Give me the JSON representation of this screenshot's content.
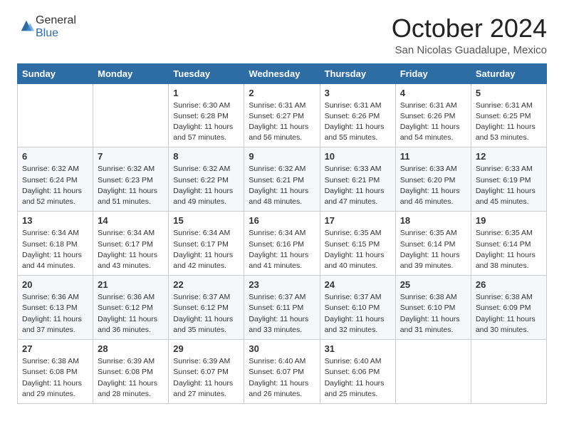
{
  "logo": {
    "general": "General",
    "blue": "Blue"
  },
  "title": "October 2024",
  "location": "San Nicolas Guadalupe, Mexico",
  "days_header": [
    "Sunday",
    "Monday",
    "Tuesday",
    "Wednesday",
    "Thursday",
    "Friday",
    "Saturday"
  ],
  "weeks": [
    [
      {
        "day": "",
        "info": ""
      },
      {
        "day": "",
        "info": ""
      },
      {
        "day": "1",
        "info": "Sunrise: 6:30 AM\nSunset: 6:28 PM\nDaylight: 11 hours and 57 minutes."
      },
      {
        "day": "2",
        "info": "Sunrise: 6:31 AM\nSunset: 6:27 PM\nDaylight: 11 hours and 56 minutes."
      },
      {
        "day": "3",
        "info": "Sunrise: 6:31 AM\nSunset: 6:26 PM\nDaylight: 11 hours and 55 minutes."
      },
      {
        "day": "4",
        "info": "Sunrise: 6:31 AM\nSunset: 6:26 PM\nDaylight: 11 hours and 54 minutes."
      },
      {
        "day": "5",
        "info": "Sunrise: 6:31 AM\nSunset: 6:25 PM\nDaylight: 11 hours and 53 minutes."
      }
    ],
    [
      {
        "day": "6",
        "info": "Sunrise: 6:32 AM\nSunset: 6:24 PM\nDaylight: 11 hours and 52 minutes."
      },
      {
        "day": "7",
        "info": "Sunrise: 6:32 AM\nSunset: 6:23 PM\nDaylight: 11 hours and 51 minutes."
      },
      {
        "day": "8",
        "info": "Sunrise: 6:32 AM\nSunset: 6:22 PM\nDaylight: 11 hours and 49 minutes."
      },
      {
        "day": "9",
        "info": "Sunrise: 6:32 AM\nSunset: 6:21 PM\nDaylight: 11 hours and 48 minutes."
      },
      {
        "day": "10",
        "info": "Sunrise: 6:33 AM\nSunset: 6:21 PM\nDaylight: 11 hours and 47 minutes."
      },
      {
        "day": "11",
        "info": "Sunrise: 6:33 AM\nSunset: 6:20 PM\nDaylight: 11 hours and 46 minutes."
      },
      {
        "day": "12",
        "info": "Sunrise: 6:33 AM\nSunset: 6:19 PM\nDaylight: 11 hours and 45 minutes."
      }
    ],
    [
      {
        "day": "13",
        "info": "Sunrise: 6:34 AM\nSunset: 6:18 PM\nDaylight: 11 hours and 44 minutes."
      },
      {
        "day": "14",
        "info": "Sunrise: 6:34 AM\nSunset: 6:17 PM\nDaylight: 11 hours and 43 minutes."
      },
      {
        "day": "15",
        "info": "Sunrise: 6:34 AM\nSunset: 6:17 PM\nDaylight: 11 hours and 42 minutes."
      },
      {
        "day": "16",
        "info": "Sunrise: 6:34 AM\nSunset: 6:16 PM\nDaylight: 11 hours and 41 minutes."
      },
      {
        "day": "17",
        "info": "Sunrise: 6:35 AM\nSunset: 6:15 PM\nDaylight: 11 hours and 40 minutes."
      },
      {
        "day": "18",
        "info": "Sunrise: 6:35 AM\nSunset: 6:14 PM\nDaylight: 11 hours and 39 minutes."
      },
      {
        "day": "19",
        "info": "Sunrise: 6:35 AM\nSunset: 6:14 PM\nDaylight: 11 hours and 38 minutes."
      }
    ],
    [
      {
        "day": "20",
        "info": "Sunrise: 6:36 AM\nSunset: 6:13 PM\nDaylight: 11 hours and 37 minutes."
      },
      {
        "day": "21",
        "info": "Sunrise: 6:36 AM\nSunset: 6:12 PM\nDaylight: 11 hours and 36 minutes."
      },
      {
        "day": "22",
        "info": "Sunrise: 6:37 AM\nSunset: 6:12 PM\nDaylight: 11 hours and 35 minutes."
      },
      {
        "day": "23",
        "info": "Sunrise: 6:37 AM\nSunset: 6:11 PM\nDaylight: 11 hours and 33 minutes."
      },
      {
        "day": "24",
        "info": "Sunrise: 6:37 AM\nSunset: 6:10 PM\nDaylight: 11 hours and 32 minutes."
      },
      {
        "day": "25",
        "info": "Sunrise: 6:38 AM\nSunset: 6:10 PM\nDaylight: 11 hours and 31 minutes."
      },
      {
        "day": "26",
        "info": "Sunrise: 6:38 AM\nSunset: 6:09 PM\nDaylight: 11 hours and 30 minutes."
      }
    ],
    [
      {
        "day": "27",
        "info": "Sunrise: 6:38 AM\nSunset: 6:08 PM\nDaylight: 11 hours and 29 minutes."
      },
      {
        "day": "28",
        "info": "Sunrise: 6:39 AM\nSunset: 6:08 PM\nDaylight: 11 hours and 28 minutes."
      },
      {
        "day": "29",
        "info": "Sunrise: 6:39 AM\nSunset: 6:07 PM\nDaylight: 11 hours and 27 minutes."
      },
      {
        "day": "30",
        "info": "Sunrise: 6:40 AM\nSunset: 6:07 PM\nDaylight: 11 hours and 26 minutes."
      },
      {
        "day": "31",
        "info": "Sunrise: 6:40 AM\nSunset: 6:06 PM\nDaylight: 11 hours and 25 minutes."
      },
      {
        "day": "",
        "info": ""
      },
      {
        "day": "",
        "info": ""
      }
    ]
  ]
}
